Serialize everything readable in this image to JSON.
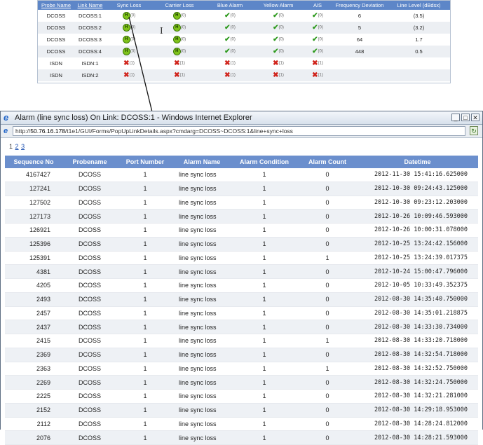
{
  "background_table": {
    "headers": [
      "Probe Name",
      "Link Name",
      "Sync Loss",
      "Carrier Loss",
      "Blue Alarm",
      "Yellow Alarm",
      "AIS",
      "Frequency Deviation",
      "Line Level (dBdsx)"
    ],
    "rows": [
      {
        "probe": "DCOSS",
        "link": "DCOSS:1",
        "sync": "(0)",
        "carrier": "(0)",
        "blue": "(0)",
        "yellow": "(0)",
        "ais": "(0)",
        "freq": "6",
        "level": "(3.5)",
        "state": "ok"
      },
      {
        "probe": "DCOSS",
        "link": "DCOSS:2",
        "sync": "(0)",
        "carrier": "(0)",
        "blue": "(0)",
        "yellow": "(0)",
        "ais": "(0)",
        "freq": "5",
        "level": "(3.2)",
        "state": "ok"
      },
      {
        "probe": "DCOSS",
        "link": "DCOSS:3",
        "sync": "(0)",
        "carrier": "(0)",
        "blue": "(0)",
        "yellow": "(0)",
        "ais": "(0)",
        "freq": "64",
        "level": "1.7",
        "state": "ok"
      },
      {
        "probe": "DCOSS",
        "link": "DCOSS:4",
        "sync": "(0)",
        "carrier": "(0)",
        "blue": "(0)",
        "yellow": "(0)",
        "ais": "(0)",
        "freq": "448",
        "level": "0.5",
        "state": "ok"
      },
      {
        "probe": "ISDN",
        "link": "ISDN:1",
        "sync": "(1)",
        "carrier": "(1)",
        "blue": "(1)",
        "yellow": "(1)",
        "ais": "(1)",
        "freq": "",
        "level": "",
        "state": "fail"
      },
      {
        "probe": "ISDN",
        "link": "ISDN:2",
        "sync": "(1)",
        "carrier": "(1)",
        "blue": "(1)",
        "yellow": "(1)",
        "ais": "(1)",
        "freq": "",
        "level": "",
        "state": "fail"
      }
    ]
  },
  "window": {
    "title": "Alarm (line sync loss) On Link: DCOSS:1 - Windows Internet Explorer",
    "address_prefix": "http://",
    "address_host": "50.76.16.178",
    "address_path": "/t1e1/GUI/Forms/PopUpLinkDetails.aspx?cmdarg=DCOSS~DCOSS:1&line+sync+loss",
    "minimize_glyph": "_",
    "maximize_glyph": "□",
    "close_glyph": "✕"
  },
  "pager": {
    "current": "1",
    "pages": [
      "2",
      "3"
    ]
  },
  "grid": {
    "headers": [
      "Sequence No",
      "Probename",
      "Port Number",
      "Alarm Name",
      "Alarm Condition",
      "Alarm Count",
      "Datetime"
    ],
    "rows": [
      {
        "seq": "4167427",
        "probe": "DCOSS",
        "port": "1",
        "name": "line sync loss",
        "cond": "1",
        "count": "0",
        "dt": "2012-11-30 15:41:16.625000"
      },
      {
        "seq": "127241",
        "probe": "DCOSS",
        "port": "1",
        "name": "line sync loss",
        "cond": "1",
        "count": "0",
        "dt": "2012-10-30 09:24:43.125000"
      },
      {
        "seq": "127502",
        "probe": "DCOSS",
        "port": "1",
        "name": "line sync loss",
        "cond": "1",
        "count": "0",
        "dt": "2012-10-30 09:23:12.203000"
      },
      {
        "seq": "127173",
        "probe": "DCOSS",
        "port": "1",
        "name": "line sync loss",
        "cond": "1",
        "count": "0",
        "dt": "2012-10-26 10:09:46.593000"
      },
      {
        "seq": "126921",
        "probe": "DCOSS",
        "port": "1",
        "name": "line sync loss",
        "cond": "1",
        "count": "0",
        "dt": "2012-10-26 10:00:31.078000"
      },
      {
        "seq": "125396",
        "probe": "DCOSS",
        "port": "1",
        "name": "line sync loss",
        "cond": "1",
        "count": "0",
        "dt": "2012-10-25 13:24:42.156000"
      },
      {
        "seq": "125391",
        "probe": "DCOSS",
        "port": "1",
        "name": "line sync loss",
        "cond": "1",
        "count": "1",
        "dt": "2012-10-25 13:24:39.017375"
      },
      {
        "seq": "4381",
        "probe": "DCOSS",
        "port": "1",
        "name": "line sync loss",
        "cond": "1",
        "count": "0",
        "dt": "2012-10-24 15:00:47.796000"
      },
      {
        "seq": "4205",
        "probe": "DCOSS",
        "port": "1",
        "name": "line sync loss",
        "cond": "1",
        "count": "0",
        "dt": "2012-10-05 10:33:49.352375"
      },
      {
        "seq": "2493",
        "probe": "DCOSS",
        "port": "1",
        "name": "line sync loss",
        "cond": "1",
        "count": "0",
        "dt": "2012-08-30 14:35:40.750000"
      },
      {
        "seq": "2457",
        "probe": "DCOSS",
        "port": "1",
        "name": "line sync loss",
        "cond": "1",
        "count": "0",
        "dt": "2012-08-30 14:35:01.218875"
      },
      {
        "seq": "2437",
        "probe": "DCOSS",
        "port": "1",
        "name": "line sync loss",
        "cond": "1",
        "count": "0",
        "dt": "2012-08-30 14:33:30.734000"
      },
      {
        "seq": "2415",
        "probe": "DCOSS",
        "port": "1",
        "name": "line sync loss",
        "cond": "1",
        "count": "1",
        "dt": "2012-08-30 14:33:20.718000"
      },
      {
        "seq": "2369",
        "probe": "DCOSS",
        "port": "1",
        "name": "line sync loss",
        "cond": "1",
        "count": "0",
        "dt": "2012-08-30 14:32:54.718000"
      },
      {
        "seq": "2363",
        "probe": "DCOSS",
        "port": "1",
        "name": "line sync loss",
        "cond": "1",
        "count": "1",
        "dt": "2012-08-30 14:32:52.750000"
      },
      {
        "seq": "2269",
        "probe": "DCOSS",
        "port": "1",
        "name": "line sync loss",
        "cond": "1",
        "count": "0",
        "dt": "2012-08-30 14:32:24.750000"
      },
      {
        "seq": "2225",
        "probe": "DCOSS",
        "port": "1",
        "name": "line sync loss",
        "cond": "1",
        "count": "0",
        "dt": "2012-08-30 14:32:21.281000"
      },
      {
        "seq": "2152",
        "probe": "DCOSS",
        "port": "1",
        "name": "line sync loss",
        "cond": "1",
        "count": "0",
        "dt": "2012-08-30 14:29:18.953000"
      },
      {
        "seq": "2112",
        "probe": "DCOSS",
        "port": "1",
        "name": "line sync loss",
        "cond": "1",
        "count": "0",
        "dt": "2012-08-30 14:28:24.812000"
      },
      {
        "seq": "2076",
        "probe": "DCOSS",
        "port": "1",
        "name": "line sync loss",
        "cond": "1",
        "count": "0",
        "dt": "2012-08-30 14:28:21.593000"
      }
    ]
  },
  "colors": {
    "header_blue": "#6b8fcd",
    "alarm_green": "#7fc21a",
    "alarm_red": "#d0231b"
  }
}
